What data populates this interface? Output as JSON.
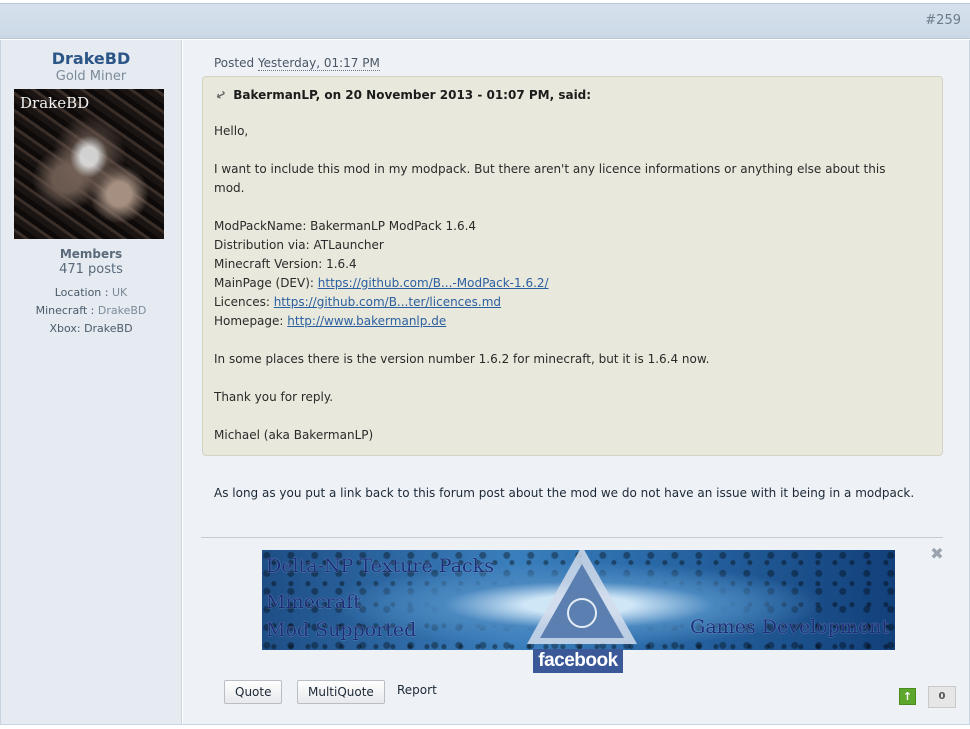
{
  "post": {
    "number": "#259",
    "posted_label": "Posted",
    "posted_date": "Yesterday, 01:17 PM"
  },
  "author": {
    "name": "DrakeBD",
    "rank": "Gold Miner",
    "avatar_text": "DrakeBD",
    "group": "Members",
    "posts": "471 posts",
    "fields": [
      {
        "label": "Location",
        "sep": " : ",
        "value": "UK"
      },
      {
        "label": "Minecraft",
        "sep": " : ",
        "value": "DrakeBD"
      },
      {
        "label": "Xbox",
        "sep": ": ",
        "value": "DrakeBD"
      }
    ]
  },
  "quote": {
    "citation": "BakermanLP, on 20 November 2013 - 01:07 PM, said:",
    "greeting": "Hello,",
    "intro_1": "I want to include this mod in my modpack. But there aren't any licence informations or anything else about this",
    "intro_2": "mod.",
    "pack_name": "ModPackName: BakermanLP ModPack 1.6.4",
    "distribution": "Distribution via: ATLauncher",
    "mc_version": "Minecraft Version: 1.6.4",
    "mainpage_label": "MainPage (DEV): ",
    "mainpage_link": "https://github.com/B...-ModPack-1.6.2/",
    "licences_label": "Licences: ",
    "licences_link": "https://github.com/B...ter/licences.md",
    "homepage_label": "Homepage: ",
    "homepage_link": "http://www.bakermanlp.de",
    "version_note": "In some places there is the version number 1.6.2 for minecraft, but it is 1.6.4 now.",
    "thanks": "Thank you for reply.",
    "signoff": "Michael (aka BakermanLP)"
  },
  "reply": {
    "text": "As long as you put a link back to this forum post about the mod we do not have an issue with it being in a modpack."
  },
  "signature": {
    "banner_line1": "Delta-NP Texture Packs",
    "banner_line2": "Minecraft",
    "banner_line3": "Mod Supported",
    "banner_right": "Games Development",
    "facebook": "facebook"
  },
  "actions": {
    "quote": "Quote",
    "multiquote": "MultiQuote",
    "report": "Report",
    "reputation": "0"
  },
  "colors": {
    "author_name": "#2c5687",
    "link": "#2b5fa0",
    "quote_bg": "#e9e8dc",
    "rep_up": "#5ea72d",
    "facebook": "#3b5998"
  },
  "icons": [
    "quote-cite-icon",
    "close-icon",
    "thumbs-up-icon"
  ]
}
